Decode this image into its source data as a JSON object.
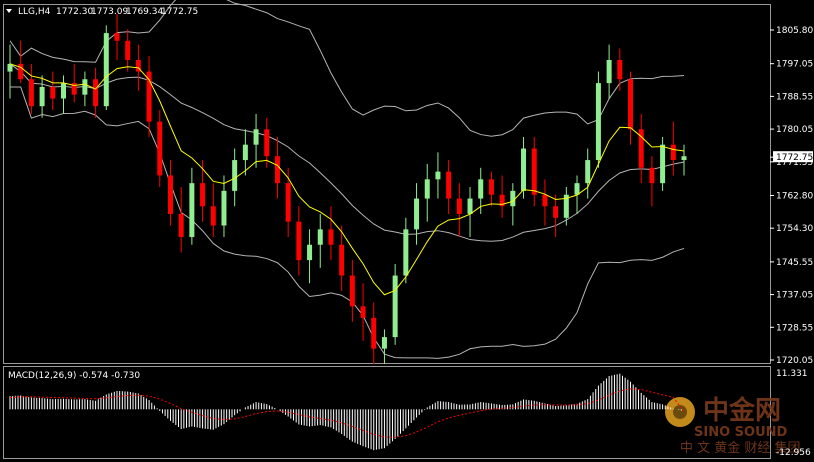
{
  "header": {
    "symbol": "LLG,H4",
    "open": "1772.30",
    "high": "1773.09",
    "low": "1769.34",
    "close": "1772.75"
  },
  "price_axis": {
    "ticks": [
      "1805.80",
      "1797.05",
      "1788.55",
      "1780.05",
      "1771.55",
      "1762.80",
      "1754.30",
      "1745.55",
      "1737.05",
      "1728.55",
      "1720.05"
    ],
    "current": "1772.75"
  },
  "macd": {
    "label": "MACD(12,26,9) -0.574 -0.730",
    "axis_top": "11.331",
    "axis_bottom": "-12.956"
  },
  "watermark": {
    "cn": "中金网",
    "en": "SINO SOUND",
    "sub": "中 文 黄金 财经 集团"
  },
  "colors": {
    "background": "#000000",
    "bull": "#90ee90",
    "bear": "#ff0000",
    "ma": "#ffff00",
    "bands": "#b4b4b4",
    "signal": "#ff0000",
    "histogram": "#ffffff"
  },
  "chart_data": {
    "type": "candlestick",
    "timeframe": "H4",
    "ylim": [
      1720.05,
      1808.5
    ],
    "candles": [
      [
        1795,
        1802,
        1788,
        1797
      ],
      [
        1797,
        1803,
        1792,
        1793
      ],
      [
        1793,
        1797,
        1784,
        1786
      ],
      [
        1786,
        1794,
        1783,
        1791
      ],
      [
        1791,
        1795,
        1785,
        1788
      ],
      [
        1788,
        1794,
        1784,
        1792
      ],
      [
        1792,
        1797,
        1787,
        1789
      ],
      [
        1789,
        1795,
        1786,
        1793
      ],
      [
        1793,
        1796,
        1783,
        1786
      ],
      [
        1786,
        1807,
        1785,
        1805
      ],
      [
        1805,
        1810,
        1798,
        1803
      ],
      [
        1803,
        1806,
        1795,
        1798
      ],
      [
        1798,
        1802,
        1790,
        1795
      ],
      [
        1795,
        1799,
        1778,
        1782
      ],
      [
        1782,
        1785,
        1765,
        1768
      ],
      [
        1768,
        1772,
        1755,
        1758
      ],
      [
        1758,
        1765,
        1748,
        1752
      ],
      [
        1752,
        1770,
        1750,
        1766
      ],
      [
        1766,
        1772,
        1756,
        1760
      ],
      [
        1760,
        1766,
        1752,
        1755
      ],
      [
        1755,
        1768,
        1752,
        1764
      ],
      [
        1764,
        1775,
        1760,
        1772
      ],
      [
        1772,
        1780,
        1768,
        1776
      ],
      [
        1776,
        1784,
        1770,
        1780
      ],
      [
        1780,
        1783,
        1770,
        1773
      ],
      [
        1773,
        1778,
        1762,
        1766
      ],
      [
        1766,
        1770,
        1752,
        1756
      ],
      [
        1756,
        1760,
        1742,
        1746
      ],
      [
        1746,
        1754,
        1740,
        1750
      ],
      [
        1750,
        1758,
        1744,
        1754
      ],
      [
        1754,
        1760,
        1746,
        1750
      ],
      [
        1750,
        1755,
        1738,
        1742
      ],
      [
        1742,
        1746,
        1730,
        1734
      ],
      [
        1734,
        1740,
        1725,
        1731
      ],
      [
        1731,
        1735,
        1719,
        1723
      ],
      [
        1723,
        1728,
        1719,
        1726
      ],
      [
        1726,
        1745,
        1724,
        1742
      ],
      [
        1742,
        1757,
        1740,
        1754
      ],
      [
        1754,
        1766,
        1750,
        1762
      ],
      [
        1762,
        1771,
        1756,
        1767
      ],
      [
        1767,
        1774,
        1762,
        1769
      ],
      [
        1769,
        1772,
        1758,
        1762
      ],
      [
        1762,
        1766,
        1752,
        1758
      ],
      [
        1758,
        1765,
        1752,
        1762
      ],
      [
        1762,
        1770,
        1758,
        1767
      ],
      [
        1767,
        1769,
        1760,
        1763
      ],
      [
        1763,
        1768,
        1757,
        1760
      ],
      [
        1760,
        1766,
        1755,
        1764
      ],
      [
        1764,
        1778,
        1762,
        1775
      ],
      [
        1775,
        1778,
        1760,
        1763
      ],
      [
        1763,
        1767,
        1755,
        1760
      ],
      [
        1760,
        1763,
        1752,
        1757
      ],
      [
        1757,
        1765,
        1755,
        1763
      ],
      [
        1763,
        1768,
        1758,
        1766
      ],
      [
        1766,
        1775,
        1762,
        1772
      ],
      [
        1772,
        1795,
        1770,
        1792
      ],
      [
        1792,
        1802,
        1788,
        1798
      ],
      [
        1798,
        1801,
        1790,
        1793
      ],
      [
        1793,
        1795,
        1776,
        1780
      ],
      [
        1780,
        1784,
        1766,
        1770
      ],
      [
        1770,
        1773,
        1760,
        1766
      ],
      [
        1766,
        1778,
        1764,
        1776
      ],
      [
        1776,
        1782,
        1768,
        1772
      ],
      [
        1772,
        1776,
        1768,
        1773
      ]
    ],
    "macd_main": [
      4,
      4.2,
      3.6,
      3.4,
      3.1,
      3.2,
      3,
      3.1,
      2.6,
      4.5,
      5.6,
      5.4,
      4.8,
      2.8,
      -0.5,
      -3.5,
      -6,
      -5.2,
      -5.8,
      -6.2,
      -4.5,
      -1.8,
      0.6,
      2.2,
      1.6,
      0,
      -2.2,
      -4.6,
      -5.2,
      -4.8,
      -5.5,
      -7.5,
      -9.8,
      -11.2,
      -12.4,
      -11.8,
      -9,
      -5.8,
      -2.5,
      0.6,
      2.5,
      2.2,
      1.4,
      1.5,
      2.2,
      1.8,
      1.3,
      1.5,
      3,
      2.6,
      1.8,
      1,
      1.2,
      1.7,
      3.1,
      7.2,
      10.1,
      10.8,
      8.4,
      5,
      2.2,
      1.5,
      0.2,
      -0.57
    ],
    "macd_signal": [
      3.6,
      3.8,
      3.8,
      3.7,
      3.6,
      3.5,
      3.4,
      3.3,
      3.2,
      3.5,
      3.9,
      4.2,
      4.3,
      4,
      3.1,
      1.8,
      0.2,
      -0.9,
      -1.9,
      -2.8,
      -3.1,
      -2.9,
      -2.2,
      -1.3,
      -0.7,
      -0.5,
      -0.9,
      -1.6,
      -2.3,
      -2.8,
      -3.3,
      -4.1,
      -5.2,
      -6.4,
      -7.6,
      -8.4,
      -8.5,
      -8,
      -6.9,
      -5.4,
      -3.8,
      -2.6,
      -1.8,
      -1.1,
      -0.4,
      0.1,
      0.3,
      0.5,
      1,
      1.3,
      1.4,
      1.3,
      1.3,
      1.4,
      1.7,
      2.8,
      4.3,
      5.6,
      6.2,
      6,
      5.2,
      4.4,
      3.6,
      -0.73
    ]
  }
}
